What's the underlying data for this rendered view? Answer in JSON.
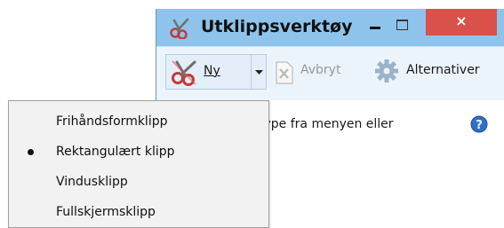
{
  "window": {
    "title": "Utklippsverktøy",
    "app_icon": "scissors-icon",
    "minimize_icon": "minimize-icon",
    "maximize_icon": "maximize-icon",
    "close_label": "×"
  },
  "toolbar": {
    "new_label": "Ny",
    "new_icon": "scissors-icon",
    "new_dropdown_icon": "chevron-down-icon",
    "cancel_label": "Avbryt",
    "cancel_icon": "cancel-x-icon",
    "cancel_enabled": false,
    "options_label": "Alternativer",
    "options_icon": "gear-icon"
  },
  "content": {
    "instruction_text": "type fra menyen eller",
    "help_icon": "help-icon"
  },
  "menu": {
    "items": [
      {
        "label": "Frihåndsformklipp",
        "selected": false
      },
      {
        "label": "Rektangulært klipp",
        "selected": true
      },
      {
        "label": "Vindusklipp",
        "selected": false
      },
      {
        "label": "Fullskjermsklipp",
        "selected": false
      }
    ]
  },
  "colors": {
    "window_frame": "#8ec4ec",
    "close_button": "#d9514a",
    "toolbar_bg": "#ebf4fb",
    "menu_bg": "#f2f2f2"
  }
}
